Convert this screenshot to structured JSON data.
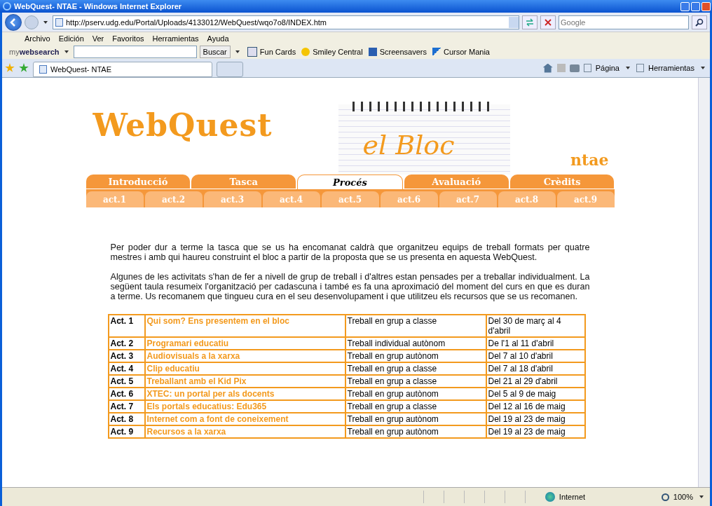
{
  "window": {
    "title": "WebQuest- NTAE - Windows Internet Explorer"
  },
  "address_bar": {
    "url": "http://pserv.udg.edu/Portal/Uploads/4133012/WebQuest/wqo7o8/INDEX.htm"
  },
  "search_box": {
    "placeholder": "Google"
  },
  "menu": [
    "Archivo",
    "Edición",
    "Ver",
    "Favoritos",
    "Herramientas",
    "Ayuda"
  ],
  "toolbar": {
    "brand": "my**websearch**",
    "search_button": "Buscar",
    "links": [
      "Fun Cards",
      "Smiley Central",
      "Screensavers",
      "Cursor Mania"
    ]
  },
  "tab_bar": {
    "tabs": [
      {
        "label": "WebQuest- NTAE",
        "selected": true
      }
    ],
    "commands": [
      "Página",
      "Herramientas"
    ]
  },
  "banner": {
    "logo": "WebQuest",
    "subtitle": "el Bloc",
    "tag": "ntae"
  },
  "nav_tabs": [
    {
      "label": "Introducció",
      "selected": false
    },
    {
      "label": "Tasca",
      "selected": false
    },
    {
      "label": "Procés",
      "selected": true
    },
    {
      "label": "Avaluació",
      "selected": false
    },
    {
      "label": "Crèdits",
      "selected": false
    }
  ],
  "activity_tabs": [
    "act.1",
    "act.2",
    "act.3",
    "act.4",
    "act.5",
    "act.6",
    "act.7",
    "act.8",
    "act.9"
  ],
  "paragraphs": [
    "Per poder dur a terme la tasca que se us ha encomanat caldrà que organitzeu equips de treball formats per quatre mestres i amb qui haureu construint el bloc a partir de la proposta que se us presenta en aquesta WebQuest.",
    "Algunes de les activitats s'han de fer a nivell de grup de treball i d'altres estan pensades per a treballar individualment. La següent taula resumeix l'organització per cadascuna i també es fa una aproximació del moment del curs en que es duran a terme. Us recomanem que tingueu cura en el seu desenvolupament i que utilitzeu els recursos que se us recomanen."
  ],
  "activities": [
    {
      "act": "Act. 1",
      "title": "Qui som? Ens presentem en el bloc",
      "mode": "Treball en grup a classe",
      "dates": "Del 30 de març al 4 d'abril"
    },
    {
      "act": "Act. 2",
      "title": "Programari educatiu",
      "mode": "Treball individual autònom",
      "dates": "De l'1 al 11 d'abril"
    },
    {
      "act": "Act. 3",
      "title": "Audiovisuals a la xarxa",
      "mode": "Treball en grup autònom",
      "dates": "Del 7 al 10 d'abril"
    },
    {
      "act": "Act. 4",
      "title": "Clip educatiu",
      "mode": "Treball en grup a classe",
      "dates": "Del 7 al 18 d'abril"
    },
    {
      "act": "Act. 5",
      "title": "Treballant amb el Kid Pix",
      "mode": "Treball en grup a classe",
      "dates": "Del 21 al 29 d'abril"
    },
    {
      "act": "Act. 6",
      "title": "XTEC: un portal per als docents",
      "mode": "Treball en grup autònom",
      "dates": "Del 5 al 9 de maig"
    },
    {
      "act": "Act. 7",
      "title": "Els portals educatius: Edu365",
      "mode": "Treball en grup a classe",
      "dates": "Del 12 al 16 de maig"
    },
    {
      "act": "Act. 8",
      "title": "Internet com a font de coneixement",
      "mode": "Treball en grup autònom",
      "dates": "Del 19 al 23 de maig"
    },
    {
      "act": "Act. 9",
      "title": "Recursos a la xarxa",
      "mode": "Treball en grup autònom",
      "dates": "Del 19 al 23 de maig"
    }
  ],
  "status_bar": {
    "zone": "Internet",
    "zoom": "100%"
  }
}
